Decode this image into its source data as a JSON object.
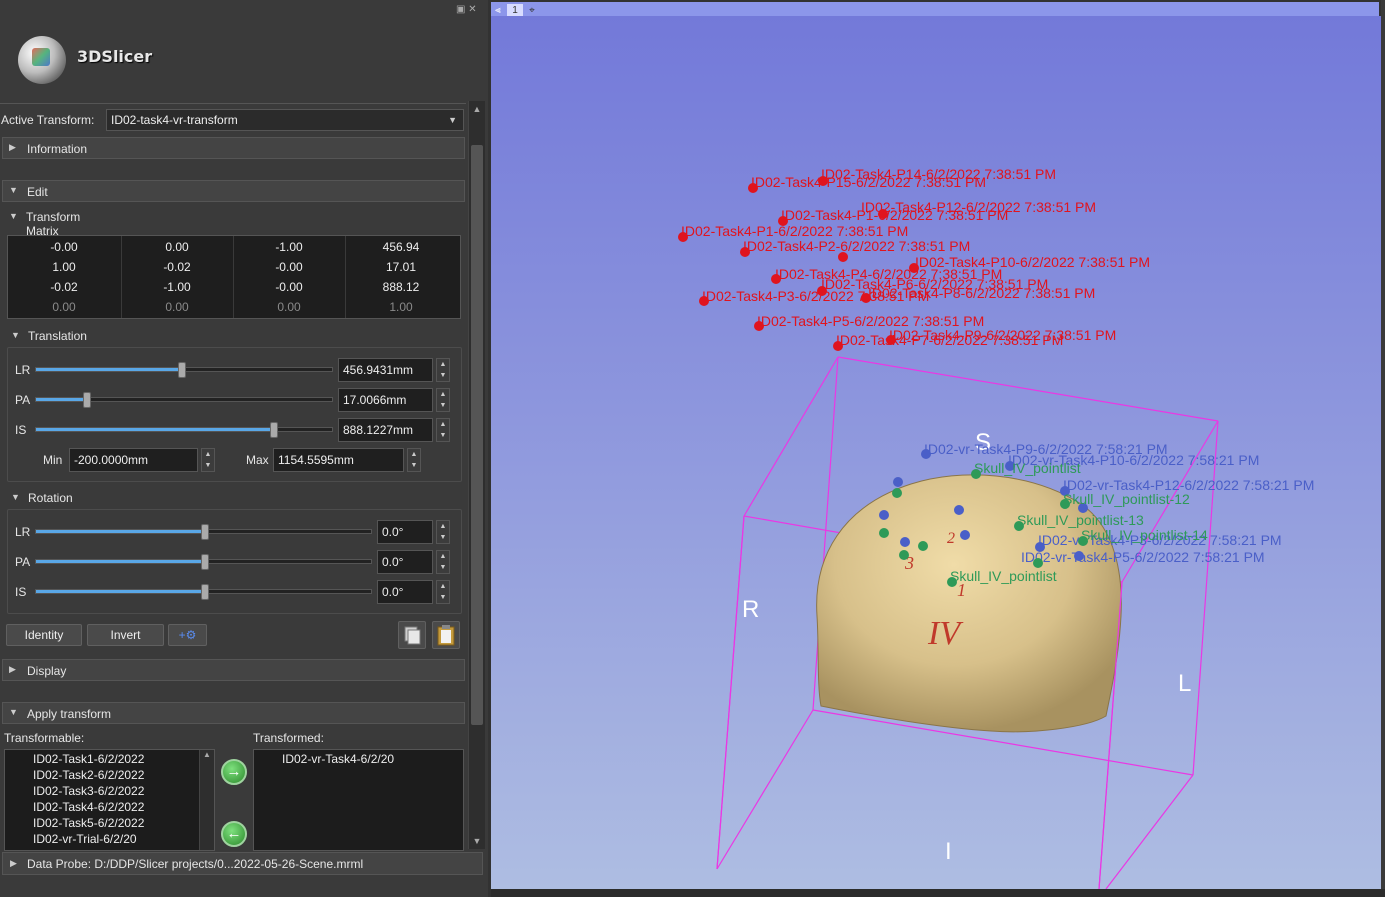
{
  "app": {
    "name": "3DSlicer"
  },
  "active_transform": {
    "label": "Active Transform:",
    "value": "ID02-task4-vr-transform"
  },
  "sections": {
    "information": "Information",
    "edit": "Edit",
    "transform_matrix": "Transform Matrix",
    "translation": "Translation",
    "rotation": "Rotation",
    "display": "Display",
    "apply_transform": "Apply transform"
  },
  "matrix": [
    [
      "-0.00",
      "0.00",
      "-1.00",
      "456.94"
    ],
    [
      "1.00",
      "-0.02",
      "-0.00",
      "17.01"
    ],
    [
      "-0.02",
      "-1.00",
      "-0.00",
      "888.12"
    ],
    [
      "0.00",
      "0.00",
      "0.00",
      "1.00"
    ]
  ],
  "translation": {
    "lr": {
      "label": "LR",
      "value": "456.9431mm",
      "fraction": 0.49
    },
    "pa": {
      "label": "PA",
      "value": "17.0066mm",
      "fraction": 0.17
    },
    "is": {
      "label": "IS",
      "value": "888.1227mm",
      "fraction": 0.8
    },
    "min_label": "Min",
    "min_value": "-200.0000mm",
    "max_label": "Max",
    "max_value": "1154.5595mm"
  },
  "rotation": {
    "lr": {
      "label": "LR",
      "value": "0.0°",
      "fraction": 0.5
    },
    "pa": {
      "label": "PA",
      "value": "0.0°",
      "fraction": 0.5
    },
    "is": {
      "label": "IS",
      "value": "0.0°",
      "fraction": 0.5
    }
  },
  "buttons": {
    "identity": "Identity",
    "invert": "Invert"
  },
  "apply": {
    "transformable_label": "Transformable:",
    "transformed_label": "Transformed:",
    "transformable": [
      "ID02-Task1-6/2/2022",
      "ID02-Task2-6/2/2022",
      "ID02-Task3-6/2/2022",
      "ID02-Task4-6/2/2022",
      "ID02-Task5-6/2/2022",
      "ID02-vr-Trial-6/2/20"
    ],
    "transformed": [
      "ID02-vr-Task4-6/2/20"
    ]
  },
  "data_probe": "Data Probe: D:/DDP/Slicer projects/0...2022-05-26-Scene.mrml",
  "view": {
    "number": "1",
    "orientation": {
      "S": "S",
      "R": "R",
      "L": "L",
      "I": "I"
    },
    "colors": {
      "red": "#e0141e",
      "blue": "#4a5fc8",
      "green": "#2e9a58",
      "box": "#ea37e4",
      "skull": "#d9c48f"
    },
    "red_labels": [
      "ID02-Task4-P14-6/2/2022 7:38:51 PM",
      "ID02-Task4-P15-6/2/2022 7:38:51 PM",
      "ID02-Task4-P12-6/2/2022 7:38:51 PM",
      "ID02-Task4-P1-6/2/2022 7:38:51 PM",
      "ID02-Task4-P1-6/2/2022 7:38:51 PM",
      "ID02-Task4-P2-6/2/2022 7:38:51 PM",
      "ID02-Task4-P10-6/2/2022 7:38:51 PM",
      "ID02-Task4-P4-6/2/2022 7:38:51 PM",
      "ID02-Task4-P6-6/2/2022 7:38:51 PM",
      "ID02-Task4-P3-6/2/2022 7:38:51 PM",
      "ID02-Task4-P8-6/2/2022 7:38:51 PM",
      "ID02-Task4-P5-6/2/2022 7:38:51 PM",
      "ID02-Task4-P9-6/2/2022 7:38:51 PM",
      "ID02-Task4-P7-6/2/2022 7:38:51 PM"
    ],
    "blue_labels": [
      "ID02-vr-Task4-P9-6/2/2022 7:58:21 PM",
      "ID02-vr-Task4-P10-6/2/2022 7:58:21 PM",
      "ID02-vr-Task4-P12-6/2/2022 7:58:21 PM",
      "ID02-vr-Task4-P3-6/2/2022 7:58:21 PM",
      "ID02-vr-Task4-P5-6/2/2022 7:58:21 PM"
    ],
    "green_labels": [
      "Skull_IV_pointlist",
      "Skull_IV_pointlist-12",
      "Skull_IV_pointlist-13",
      "Skull_IV_pointlist-14",
      "Skull_IV_pointlist"
    ],
    "skull_text": {
      "iv": "IV",
      "one": "1",
      "three": "3",
      "two": "2"
    }
  }
}
